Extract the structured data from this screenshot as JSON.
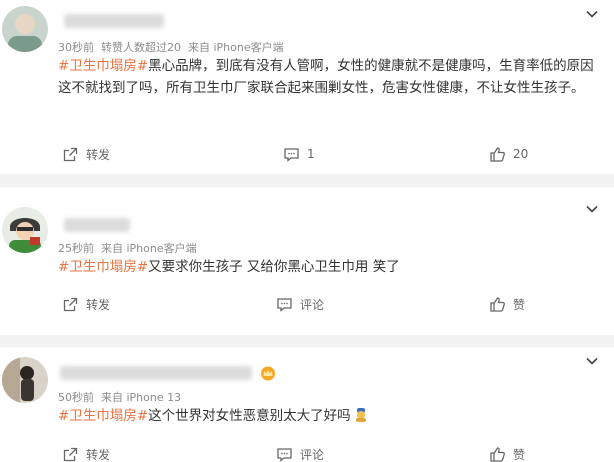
{
  "comments": [
    {
      "meta": {
        "time": "30秒前",
        "reposts": "转赞人数超过20",
        "source": "来自 iPhone客户端"
      },
      "topic": "#卫生巾塌房#",
      "body": "黑心品牌，到底有没有人管啊，女性的健康就不是健康吗，生育率低的原因这不就找到了吗，所有卫生巾厂家联合起来围剿女性，危害女性健康，不让女性生孩子。",
      "actions": {
        "repost": "转发",
        "comment": "1",
        "like": "20"
      }
    },
    {
      "meta": {
        "time": "25秒前",
        "source": "来自 iPhone客户端"
      },
      "topic": "#卫生巾塌房#",
      "body": "又要求你生孩子 又给你黑心卫生巾用 笑了",
      "actions": {
        "repost": "转发",
        "comment": "评论",
        "like": "赞"
      }
    },
    {
      "meta": {
        "time": "50秒前",
        "source": "来自 iPhone 13"
      },
      "topic": "#卫生巾塌房#",
      "body": "这个世界对女性恶意别太大了好吗",
      "actions": {
        "repost": "转发",
        "comment": "评论",
        "like": "赞"
      }
    }
  ],
  "colors": {
    "topic": "#eb7340",
    "meta": "#8c8c8c",
    "body": "#333333",
    "divider": "#f2f2f2"
  },
  "icons": [
    "chevron-down-icon",
    "repost-icon",
    "comment-icon",
    "like-icon",
    "crown-icon",
    "emoji-icon"
  ]
}
